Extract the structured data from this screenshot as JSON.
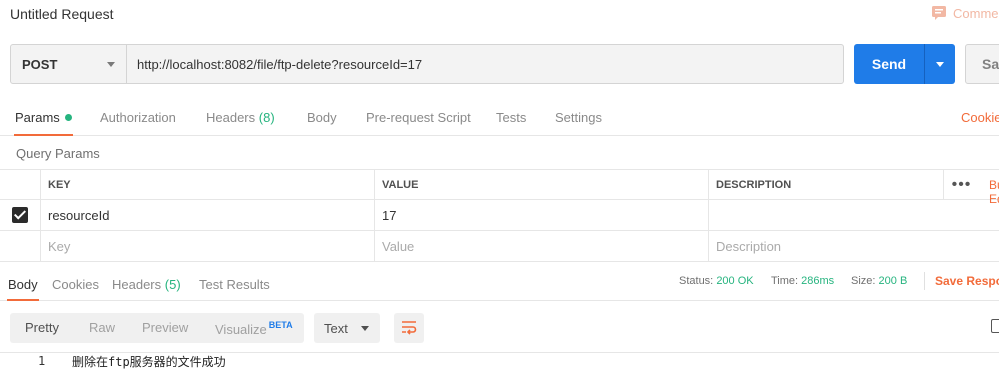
{
  "header": {
    "title": "Untitled Request",
    "comments_label": "Comments"
  },
  "request": {
    "method": "POST",
    "url": "http://localhost:8082/file/ftp-delete?resourceId=17",
    "send_label": "Send",
    "save_label": "Save"
  },
  "req_tabs": {
    "params": "Params",
    "authorization": "Authorization",
    "headers": "Headers",
    "headers_count": "(8)",
    "body": "Body",
    "prerequest": "Pre-request Script",
    "tests": "Tests",
    "settings": "Settings",
    "cookies": "Cookies"
  },
  "query_params": {
    "label": "Query Params",
    "columns": {
      "key": "KEY",
      "value": "VALUE",
      "description": "DESCRIPTION"
    },
    "more": "•••",
    "bulk_edit": "Bulk Edit",
    "rows": [
      {
        "checked": true,
        "key": "resourceId",
        "value": "17",
        "description": ""
      }
    ],
    "placeholders": {
      "key": "Key",
      "value": "Value",
      "description": "Description"
    }
  },
  "response": {
    "tabs": {
      "body": "Body",
      "cookies": "Cookies",
      "headers": "Headers",
      "headers_count": "(5)",
      "test_results": "Test Results"
    },
    "status_label": "Status:",
    "status_value": "200 OK",
    "time_label": "Time:",
    "time_value": "286ms",
    "size_label": "Size:",
    "size_value": "200 B",
    "save_response": "Save Response",
    "view_modes": {
      "pretty": "Pretty",
      "raw": "Raw",
      "preview": "Preview",
      "visualize": "Visualize",
      "beta": "BETA"
    },
    "format": "Text",
    "lines": [
      {
        "no": "1",
        "text": "删除在ftp服务器的文件成功"
      }
    ]
  },
  "colors": {
    "accent": "#f26b3a",
    "primary": "#1f7ce8",
    "success": "#26b47f"
  },
  "icons": [
    "comment-icon",
    "chevron-down-icon",
    "check-icon",
    "more-icon",
    "wrap-lines-icon",
    "copy-icon"
  ]
}
